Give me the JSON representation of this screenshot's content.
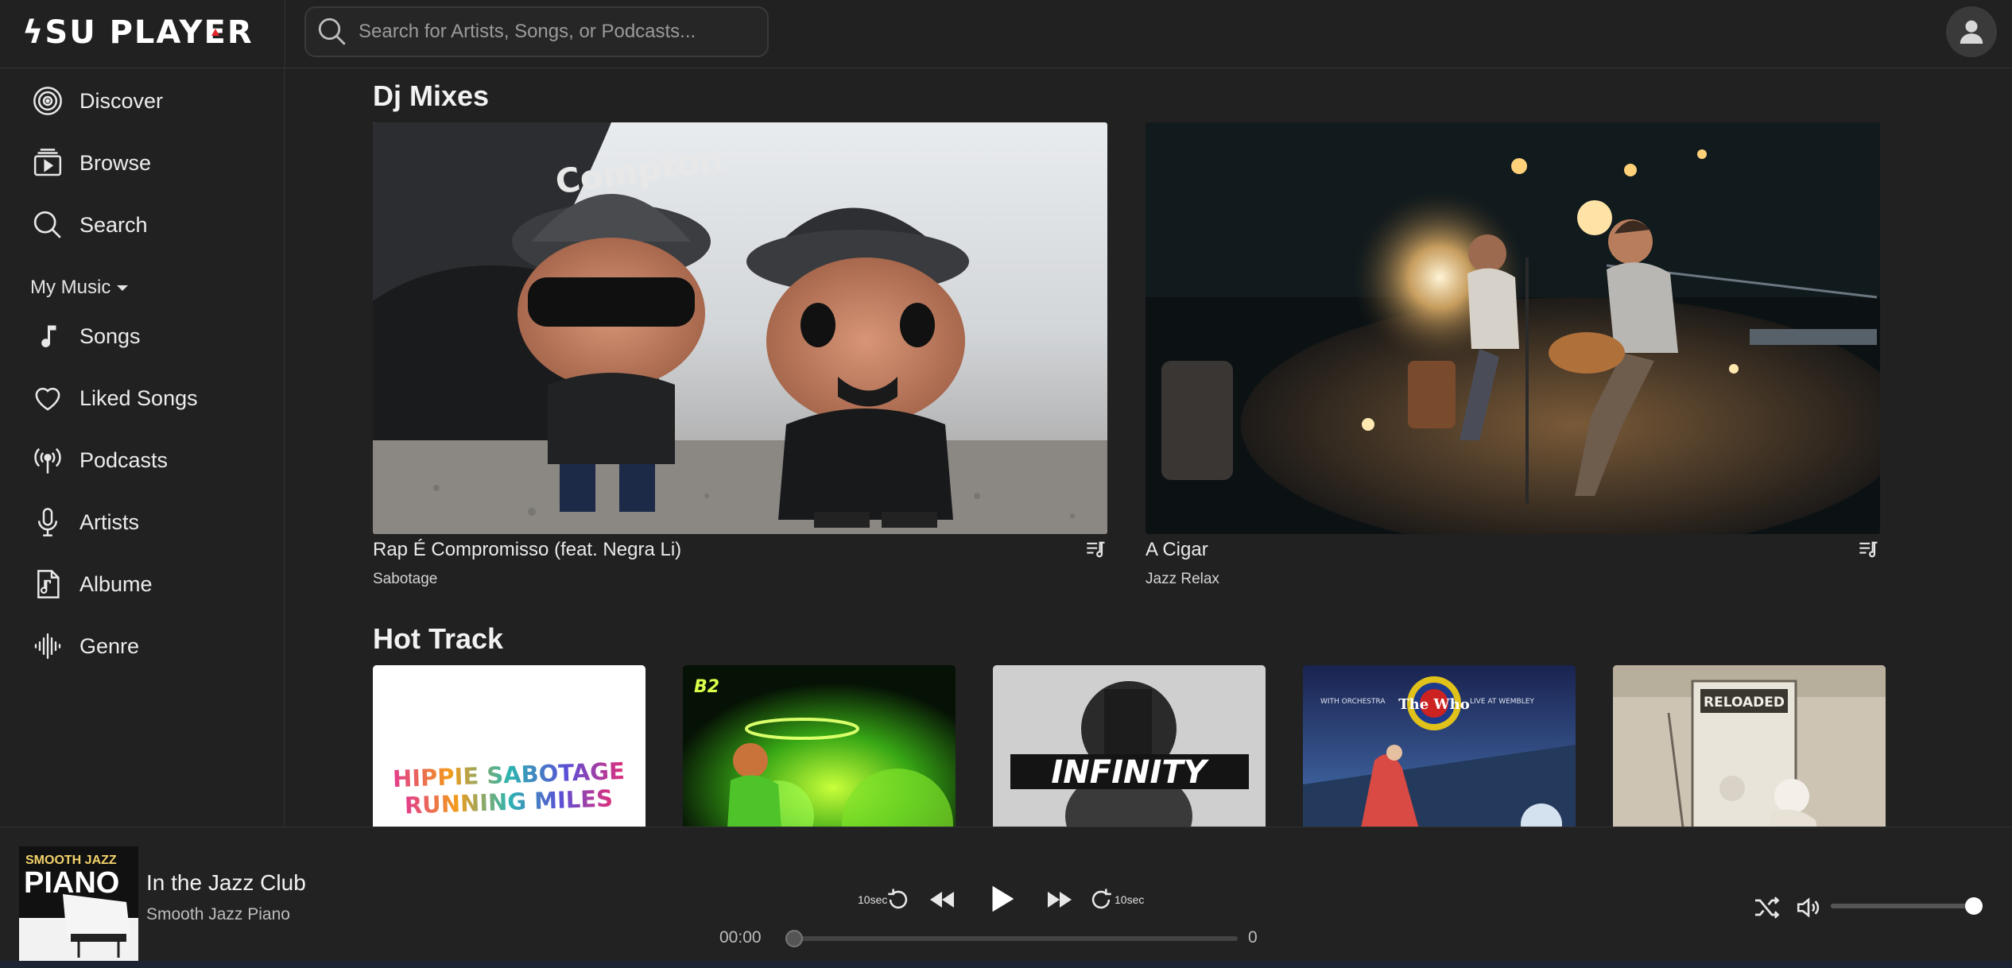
{
  "app": {
    "logo_text_a": "SU",
    "logo_text_prefix": "ϟ",
    "logo_text_b": "SU PLAY",
    "logo_text_c": "E",
    "logo_text_d": "R",
    "logo_accent_color": "#e5252a"
  },
  "search": {
    "placeholder": "Search for Artists, Songs, or Podcasts..."
  },
  "sidebar": {
    "items": [
      {
        "label": "Discover",
        "icon": "discover-target-icon"
      },
      {
        "label": "Browse",
        "icon": "browse-play-icon"
      },
      {
        "label": "Search",
        "icon": "search-icon"
      }
    ],
    "my_music_label": "My Music",
    "music_items": [
      {
        "label": "Songs",
        "icon": "music-note-icon"
      },
      {
        "label": "Liked Songs",
        "icon": "heart-icon"
      },
      {
        "label": "Podcasts",
        "icon": "podcast-broadcast-icon"
      },
      {
        "label": "Artists",
        "icon": "microphone-icon"
      },
      {
        "label": "Albume",
        "icon": "music-file-icon"
      },
      {
        "label": "Genre",
        "icon": "waveform-icon"
      }
    ]
  },
  "sections": {
    "dj_mixes_title": "Dj Mixes",
    "hot_track_title": "Hot Track"
  },
  "dj_mixes": [
    {
      "title": "Rap É Compromisso (feat. Negra Li)",
      "artist": "Sabotage"
    },
    {
      "title": "A Cigar",
      "artist": "Jazz Relax"
    }
  ],
  "hot_tracks": [
    {
      "cover_text_1": "HIPPIE SABOTAGE",
      "cover_text_2": "RUNNING MILES"
    },
    {
      "cover_text_1": "B2"
    },
    {
      "cover_text_1": "INFINITY"
    },
    {
      "cover_text_1": "WITH ORCHESTRA",
      "cover_text_2": "LIVE AT WEMBLEY",
      "cover_text_3": "The Who"
    },
    {
      "cover_text_1": "RELOADED"
    }
  ],
  "player": {
    "title": "In the Jazz Club",
    "artist": "Smooth Jazz Piano",
    "art_text_1": "SMOOTH JAZZ",
    "art_text_2": "PIANO",
    "rewind_label": "10sec",
    "forward_label": "10sec",
    "current_time": "00:00",
    "duration": "0",
    "progress_fraction": 0,
    "volume_fraction": 1
  }
}
